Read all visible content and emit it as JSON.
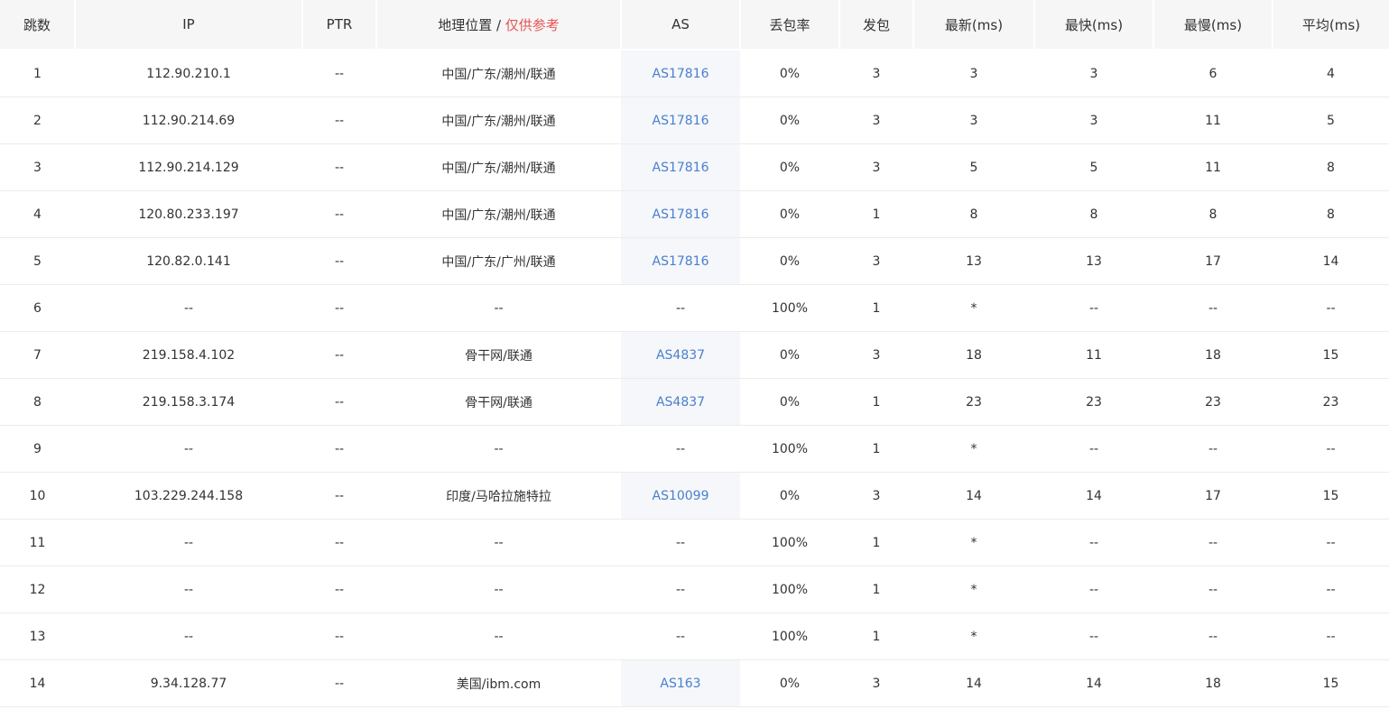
{
  "table": {
    "headers": {
      "hop": "跳数",
      "ip": "IP",
      "ptr": "PTR",
      "geo": "地理位置",
      "geo_sep": " / ",
      "geo_note": "仅供参考",
      "as": "AS",
      "loss": "丢包率",
      "sent": "发包",
      "last": "最新(ms)",
      "best": "最快(ms)",
      "worst": "最慢(ms)",
      "avg": "平均(ms)"
    },
    "rows": [
      {
        "hop": "1",
        "ip": "112.90.210.1",
        "ptr": "--",
        "geo": "中国/广东/潮州/联通",
        "as": "AS17816",
        "loss": "0%",
        "sent": "3",
        "last": "3",
        "best": "3",
        "worst": "6",
        "avg": "4"
      },
      {
        "hop": "2",
        "ip": "112.90.214.69",
        "ptr": "--",
        "geo": "中国/广东/潮州/联通",
        "as": "AS17816",
        "loss": "0%",
        "sent": "3",
        "last": "3",
        "best": "3",
        "worst": "11",
        "avg": "5"
      },
      {
        "hop": "3",
        "ip": "112.90.214.129",
        "ptr": "--",
        "geo": "中国/广东/潮州/联通",
        "as": "AS17816",
        "loss": "0%",
        "sent": "3",
        "last": "5",
        "best": "5",
        "worst": "11",
        "avg": "8"
      },
      {
        "hop": "4",
        "ip": "120.80.233.197",
        "ptr": "--",
        "geo": "中国/广东/潮州/联通",
        "as": "AS17816",
        "loss": "0%",
        "sent": "1",
        "last": "8",
        "best": "8",
        "worst": "8",
        "avg": "8"
      },
      {
        "hop": "5",
        "ip": "120.82.0.141",
        "ptr": "--",
        "geo": "中国/广东/广州/联通",
        "as": "AS17816",
        "loss": "0%",
        "sent": "3",
        "last": "13",
        "best": "13",
        "worst": "17",
        "avg": "14"
      },
      {
        "hop": "6",
        "ip": "--",
        "ptr": "--",
        "geo": "--",
        "as": "--",
        "loss": "100%",
        "sent": "1",
        "last": "*",
        "best": "--",
        "worst": "--",
        "avg": "--"
      },
      {
        "hop": "7",
        "ip": "219.158.4.102",
        "ptr": "--",
        "geo": "骨干网/联通",
        "as": "AS4837",
        "loss": "0%",
        "sent": "3",
        "last": "18",
        "best": "11",
        "worst": "18",
        "avg": "15"
      },
      {
        "hop": "8",
        "ip": "219.158.3.174",
        "ptr": "--",
        "geo": "骨干网/联通",
        "as": "AS4837",
        "loss": "0%",
        "sent": "1",
        "last": "23",
        "best": "23",
        "worst": "23",
        "avg": "23"
      },
      {
        "hop": "9",
        "ip": "--",
        "ptr": "--",
        "geo": "--",
        "as": "--",
        "loss": "100%",
        "sent": "1",
        "last": "*",
        "best": "--",
        "worst": "--",
        "avg": "--"
      },
      {
        "hop": "10",
        "ip": "103.229.244.158",
        "ptr": "--",
        "geo": "印度/马哈拉施特拉",
        "as": "AS10099",
        "loss": "0%",
        "sent": "3",
        "last": "14",
        "best": "14",
        "worst": "17",
        "avg": "15"
      },
      {
        "hop": "11",
        "ip": "--",
        "ptr": "--",
        "geo": "--",
        "as": "--",
        "loss": "100%",
        "sent": "1",
        "last": "*",
        "best": "--",
        "worst": "--",
        "avg": "--"
      },
      {
        "hop": "12",
        "ip": "--",
        "ptr": "--",
        "geo": "--",
        "as": "--",
        "loss": "100%",
        "sent": "1",
        "last": "*",
        "best": "--",
        "worst": "--",
        "avg": "--"
      },
      {
        "hop": "13",
        "ip": "--",
        "ptr": "--",
        "geo": "--",
        "as": "--",
        "loss": "100%",
        "sent": "1",
        "last": "*",
        "best": "--",
        "worst": "--",
        "avg": "--"
      },
      {
        "hop": "14",
        "ip": "9.34.128.77",
        "ptr": "--",
        "geo": "美国/ibm.com",
        "as": "AS163",
        "loss": "0%",
        "sent": "3",
        "last": "14",
        "best": "14",
        "worst": "18",
        "avg": "15"
      }
    ]
  },
  "colors": {
    "header_bg": "#f6f6f6",
    "as_link": "#4a7fcf",
    "as_cell_bg": "#f5f7fa",
    "note": "#e85454",
    "row_border": "#ececec"
  }
}
